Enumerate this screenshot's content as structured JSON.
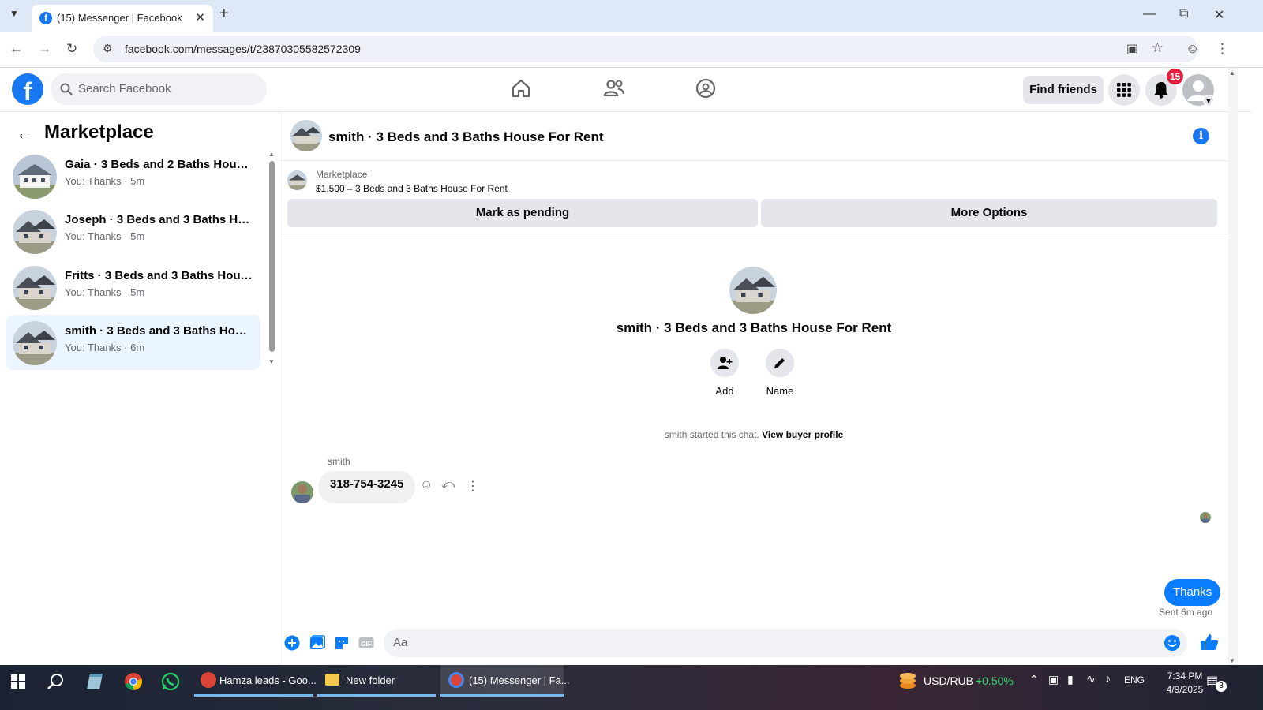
{
  "browser": {
    "tab_title": "(15) Messenger | Facebook",
    "url": "facebook.com/messages/t/23870305582572309"
  },
  "fb": {
    "logo": "f",
    "search_placeholder": "Search Facebook",
    "find_friends": "Find friends",
    "notif_count": "15"
  },
  "sidebar": {
    "title": "Marketplace",
    "conversations": [
      {
        "name": "Gaia · 3 Beds and 2 Baths House For Rent",
        "snippet": "You: Thanks · 5m"
      },
      {
        "name": "Joseph · 3 Beds and 3 Baths House For Rent",
        "snippet": "You: Thanks · 5m"
      },
      {
        "name": "Fritts · 3 Beds and 3 Baths House For Rent",
        "snippet": "You: Thanks · 5m"
      },
      {
        "name": "smith · 3 Beds and 3 Baths House For Rent",
        "snippet": "You: Thanks · 6m"
      }
    ]
  },
  "chat": {
    "title": "smith · 3 Beds and 3 Baths House For Rent",
    "marketplace_label": "Marketplace",
    "listing": "$1,500 – 3 Beds and 3 Baths House For Rent",
    "mark_pending": "Mark as pending",
    "more_options": "More Options",
    "profile_name": "smith · 3 Beds and 3 Baths House For Rent",
    "add_label": "Add",
    "name_label": "Name",
    "started_text": "smith started this chat.",
    "view_profile": "View buyer profile",
    "sender": "smith",
    "incoming_message": "318-754-3245",
    "outgoing_message": "Thanks",
    "sent_status": "Sent 6m ago",
    "input_placeholder": "Aa"
  },
  "taskbar": {
    "tasks": [
      "Hamza leads - Goo...",
      "New folder",
      "(15) Messenger | Fa..."
    ],
    "ticker": "USD/RUB",
    "ticker_change": "+0.50%",
    "lang": "ENG",
    "time": "7:34 PM",
    "date": "4/9/2025",
    "notif": "3"
  },
  "colors": {
    "fb_blue": "#1877f2",
    "bubble_out": "#0a7cff",
    "active_conv": "#ebf5ff"
  }
}
